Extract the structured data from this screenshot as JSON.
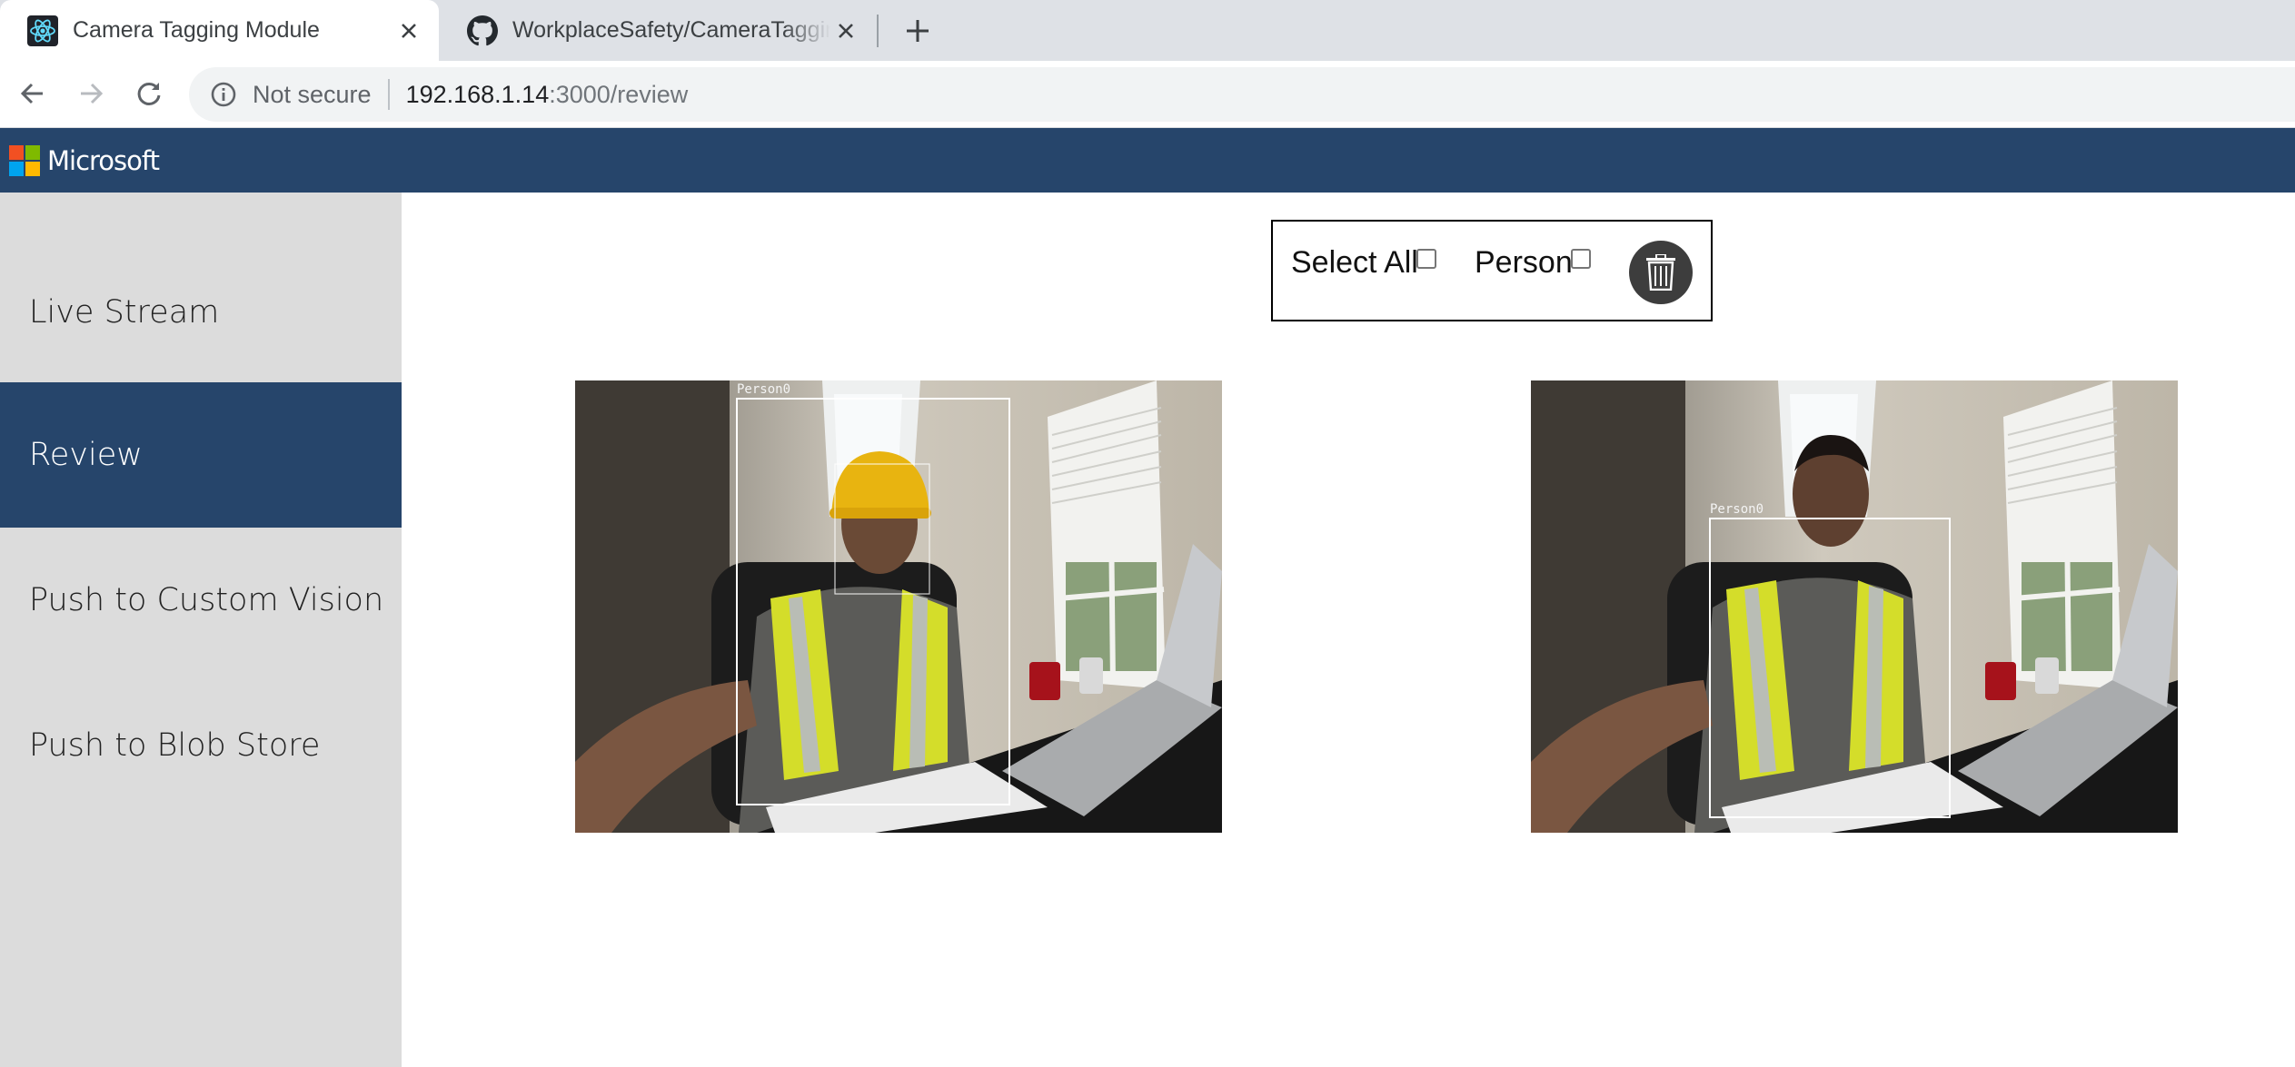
{
  "browser": {
    "tabs": [
      {
        "title": "Camera Tagging Module",
        "icon": "react-icon",
        "active": true
      },
      {
        "title": "WorkplaceSafety/CameraTagging",
        "icon": "github-icon",
        "active": false
      }
    ],
    "address": {
      "security_label": "Not secure",
      "host": "192.168.1.14",
      "path": ":3000/review"
    }
  },
  "app": {
    "brand": "Microsoft",
    "logo_colors": [
      "#f25022",
      "#7fba00",
      "#00a4ef",
      "#ffb900"
    ],
    "accent_color": "#26456b"
  },
  "sidebar": {
    "items": [
      {
        "label": "Live Stream",
        "active": false
      },
      {
        "label": "Review",
        "active": true
      },
      {
        "label": "Push to Custom Vision",
        "active": false
      },
      {
        "label": "Push to Blob Store",
        "active": false
      }
    ]
  },
  "controls": {
    "select_all_label": "Select All",
    "select_all_checked": false,
    "filter_label": "Person",
    "filter_checked": false,
    "delete_icon": "trash-icon"
  },
  "captures": [
    {
      "detection_label": "Person0"
    },
    {
      "detection_label": "Person0"
    }
  ]
}
